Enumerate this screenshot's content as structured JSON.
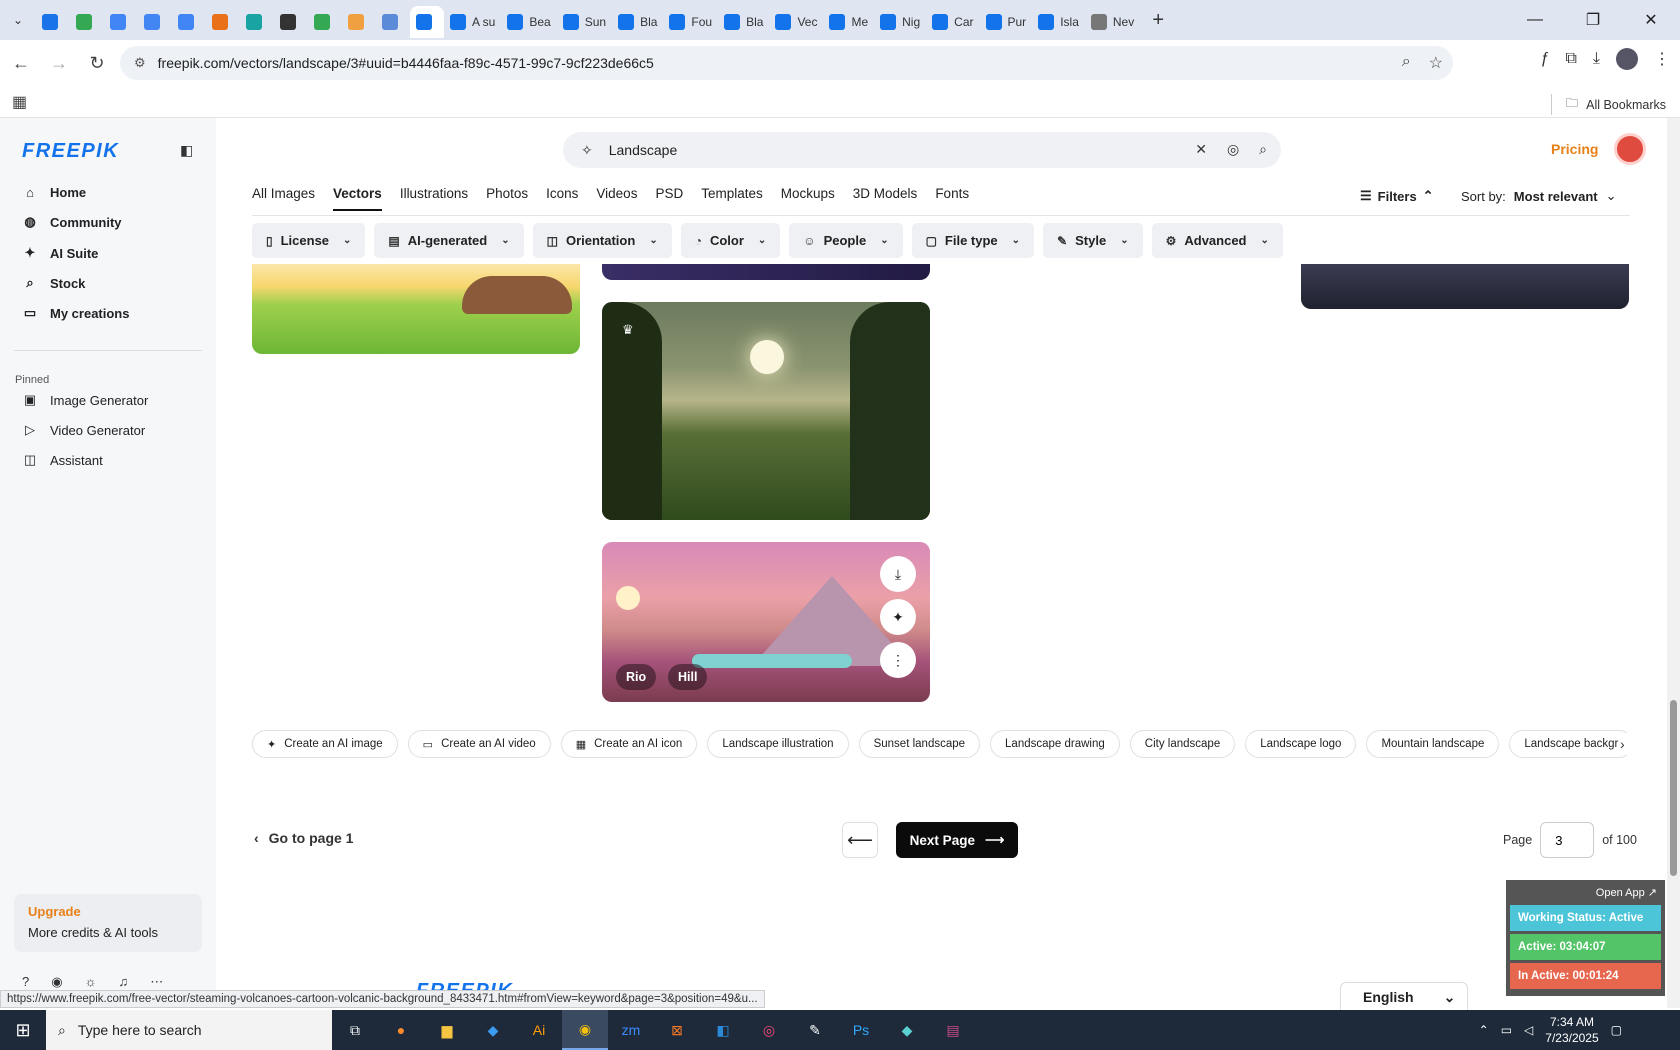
{
  "browser": {
    "tabs": [
      {
        "label": "",
        "color": "#1a73e8"
      },
      {
        "label": "",
        "color": "#34a853"
      },
      {
        "label": "",
        "color": "#4285f4"
      },
      {
        "label": "",
        "color": "#4285f4"
      },
      {
        "label": "",
        "color": "#4285f4"
      },
      {
        "label": "",
        "color": "#e8711a"
      },
      {
        "label": "",
        "color": "#1aa3a3"
      },
      {
        "label": "",
        "color": "#333333"
      },
      {
        "label": "",
        "color": "#34a853"
      },
      {
        "label": "",
        "color": "#f0a040"
      },
      {
        "label": "",
        "color": "#5a8ad8"
      },
      {
        "label": "",
        "color": "#1273eb",
        "active": true
      },
      {
        "label": "A su",
        "color": "#1273eb"
      },
      {
        "label": "Bea",
        "color": "#1273eb"
      },
      {
        "label": "Sun",
        "color": "#1273eb"
      },
      {
        "label": "Bla",
        "color": "#1273eb"
      },
      {
        "label": "Fou",
        "color": "#1273eb"
      },
      {
        "label": "Bla",
        "color": "#1273eb"
      },
      {
        "label": "Vec",
        "color": "#1273eb"
      },
      {
        "label": "Me",
        "color": "#1273eb"
      },
      {
        "label": "Nig",
        "color": "#1273eb"
      },
      {
        "label": "Car",
        "color": "#1273eb"
      },
      {
        "label": "Pur",
        "color": "#1273eb"
      },
      {
        "label": "Isla",
        "color": "#1273eb"
      },
      {
        "label": "Nev",
        "color": "#777777"
      }
    ],
    "url": "freepik.com/vectors/landscape/3#uuid=b4446faa-f89c-4571-99c7-9cf223de66c5",
    "bookmarks_label": "All Bookmarks",
    "status_url": "https://www.freepik.com/free-vector/steaming-volcanoes-cartoon-volcanic-background_8433471.htm#fromView=keyword&page=3&position=49&u..."
  },
  "sidebar": {
    "logo": "FREEPIK",
    "nav": [
      {
        "label": "Home",
        "icon": "home-icon",
        "glyph": "⌂"
      },
      {
        "label": "Community",
        "icon": "globe-icon",
        "glyph": "◍"
      },
      {
        "label": "AI Suite",
        "icon": "sparkle-icon",
        "glyph": "✦"
      },
      {
        "label": "Stock",
        "icon": "search-icon",
        "glyph": "⌕"
      },
      {
        "label": "My creations",
        "icon": "folder-icon",
        "glyph": "▭"
      }
    ],
    "pinned_label": "Pinned",
    "pinned": [
      {
        "label": "Image Generator",
        "icon": "image-icon",
        "glyph": "▣"
      },
      {
        "label": "Video Generator",
        "icon": "video-icon",
        "glyph": "▷"
      },
      {
        "label": "Assistant",
        "icon": "chat-icon",
        "glyph": "◫"
      }
    ],
    "upgrade": {
      "title": "Upgrade",
      "subtitle": "More credits & AI tools"
    }
  },
  "header": {
    "search_value": "Landscape",
    "pricing": "Pricing"
  },
  "categories": {
    "tabs": [
      "All Images",
      "Vectors",
      "Illustrations",
      "Photos",
      "Icons",
      "Videos",
      "PSD",
      "Templates",
      "Mockups",
      "3D Models",
      "Fonts"
    ],
    "active": "Vectors",
    "filters_label": "Filters",
    "sort_label": "Sort by:",
    "sort_value": "Most relevant"
  },
  "filter_pills": [
    {
      "label": "License",
      "icon": "license-icon",
      "glyph": "▯"
    },
    {
      "label": "AI-generated",
      "icon": "ai-generated-icon",
      "glyph": "▤"
    },
    {
      "label": "Orientation",
      "icon": "orientation-icon",
      "glyph": "◫"
    },
    {
      "label": "Color",
      "icon": "palette-icon",
      "glyph": "◔"
    },
    {
      "label": "People",
      "icon": "people-icon",
      "glyph": "☺"
    },
    {
      "label": "File type",
      "icon": "file-icon",
      "glyph": "▢"
    },
    {
      "label": "Style",
      "icon": "brush-icon",
      "glyph": "✎"
    },
    {
      "label": "Advanced",
      "icon": "settings-icon",
      "glyph": "⚙"
    }
  ],
  "tiles": {
    "volcano_tags": [
      "Rio",
      "Hill"
    ]
  },
  "related": [
    {
      "label": "Create an AI image",
      "icon": "sparkle-icon",
      "glyph": "✦"
    },
    {
      "label": "Create an AI video",
      "icon": "video-icon",
      "glyph": "▭"
    },
    {
      "label": "Create an AI icon",
      "icon": "grid-icon",
      "glyph": "▦"
    },
    {
      "label": "Landscape illustration"
    },
    {
      "label": "Sunset landscape"
    },
    {
      "label": "Landscape drawing"
    },
    {
      "label": "City landscape"
    },
    {
      "label": "Landscape logo"
    },
    {
      "label": "Mountain landscape"
    },
    {
      "label": "Landscape backgr"
    }
  ],
  "pagination": {
    "goto_first": "Go to page 1",
    "next": "Next Page",
    "page_label": "Page",
    "page_value": "3",
    "of_label": "of 100"
  },
  "footer": {
    "language": "English"
  },
  "work_status": {
    "open_app": "Open App ↗",
    "status": "Working Status: Active",
    "active": "Active: 03:04:07",
    "inactive": "In Active: 00:01:24"
  },
  "taskbar": {
    "search_placeholder": "Type here to search",
    "time": "7:34 AM",
    "date": "7/23/2025"
  }
}
